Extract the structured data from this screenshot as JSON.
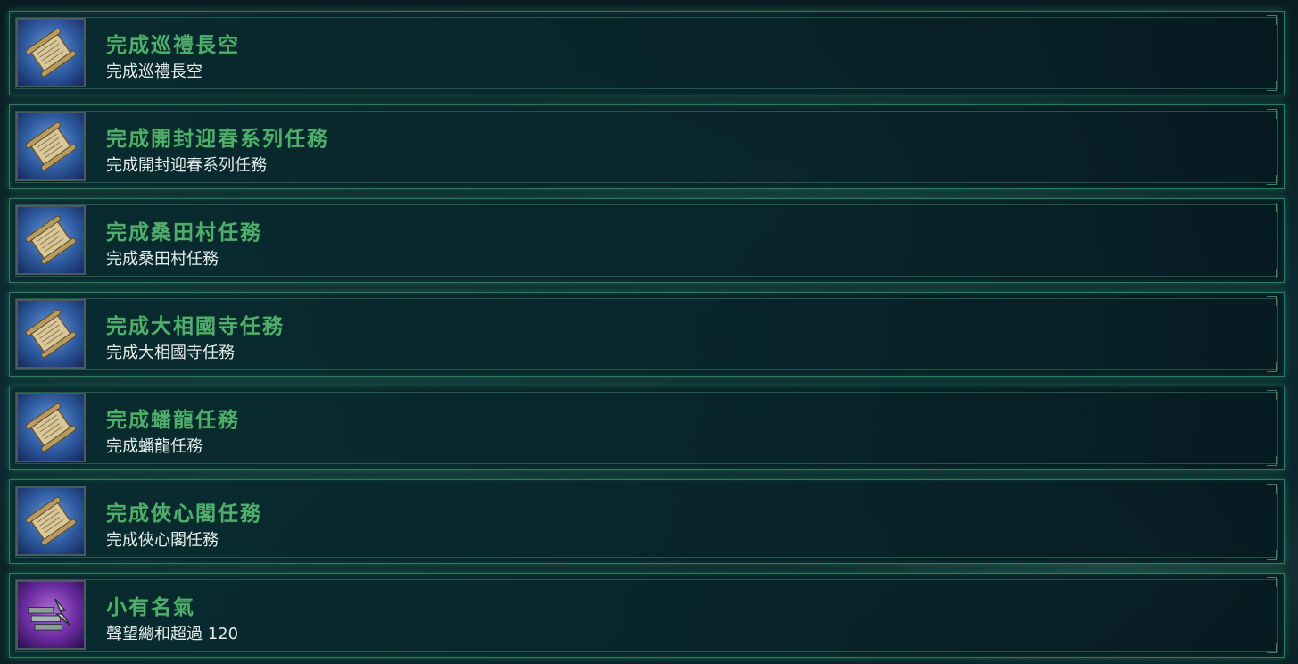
{
  "achievements": [
    {
      "icon": "scroll-icon",
      "title": "完成巡禮長空",
      "description": "完成巡禮長空"
    },
    {
      "icon": "scroll-icon",
      "title": "完成開封迎春系列任務",
      "description": "完成開封迎春系列任務"
    },
    {
      "icon": "scroll-icon",
      "title": "完成桑田村任務",
      "description": "完成桑田村任務"
    },
    {
      "icon": "scroll-icon",
      "title": "完成大相國寺任務",
      "description": "完成大相國寺任務"
    },
    {
      "icon": "scroll-icon",
      "title": "完成蟠龍任務",
      "description": "完成蟠龍任務"
    },
    {
      "icon": "scroll-icon",
      "title": "完成俠心閣任務",
      "description": "完成俠心閣任務"
    },
    {
      "icon": "reputation-icon",
      "title": "小有名氣",
      "description": "聲望總和超過 120"
    }
  ],
  "colors": {
    "title_green": "#4fae6e",
    "description_white": "#e6ecea",
    "row_border": "#2f7a5c",
    "scroll_icon_bg": "#2e5aa0",
    "reputation_icon_bg": "#6a2aa0"
  }
}
